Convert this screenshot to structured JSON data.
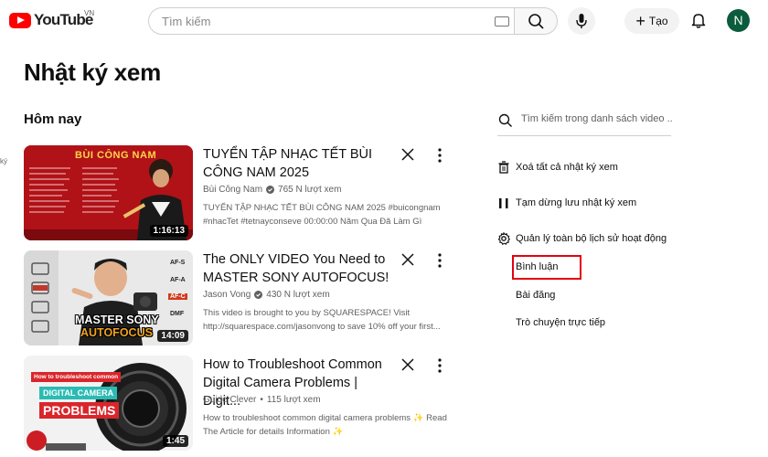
{
  "header": {
    "logo_text": "YouTube",
    "country": "VN",
    "search_placeholder": "Tìm kiếm",
    "create_label": "Tạo",
    "avatar_letter": "N"
  },
  "page": {
    "title": "Nhật ký xem",
    "section": "Hôm nay",
    "edge_label": "ký"
  },
  "videos": [
    {
      "title": "TUYỂN TẬP NHẠC TẾT BÙI CÔNG NAM 2025",
      "channel": "Bùi Công Nam",
      "views": "765 N lượt xem",
      "desc": "TUYỂN TẬP NHẠC TẾT BÙI CÔNG NAM 2025 #buicongnam #nhacTet #tetnayconseve 00:00:00 Năm Qua Đã Làm Gì 00:03:58...",
      "duration": "1:16:13",
      "thumb_text": "BÙI CÔNG NAM"
    },
    {
      "title": "The ONLY VIDEO You Need to MASTER SONY AUTOFOCUS!",
      "channel": "Jason Vong",
      "views": "430 N lượt xem",
      "desc": "This video is brought to you by SQUARESPACE! Visit http://squarespace.com/jasonvong to save 10% off your first...",
      "duration": "14:09",
      "thumb_text_1": "MASTER SONY",
      "thumb_text_2": "AUTOFOCUS",
      "thumb_tags": [
        "AF-S",
        "AF-A",
        "AF-C",
        "DMF"
      ]
    },
    {
      "title": "How to Troubleshoot Common Digital Camera Problems | Digit...",
      "channel": "Guide Clever",
      "views": "115 lượt xem",
      "desc": "How to troubleshoot common digital camera problems ✨ Read The Article for details Information ✨ https://guideclever.com/common...",
      "duration": "1:45",
      "thumb_text_1": "How to troubleshoot common",
      "thumb_text_2": "DIGITAL CAMERA",
      "thumb_text_3": "PROBLEMS"
    }
  ],
  "sidebar": {
    "search_placeholder": "Tìm kiếm trong danh sách video ...",
    "clear": "Xoá tất cả nhật ký xem",
    "pause": "Tạm dừng lưu nhật ký xem",
    "manage": "Quản lý toàn bộ lịch sử hoạt động",
    "sub": [
      "Bình luận",
      "Bài đăng",
      "Trò chuyện trực tiếp"
    ]
  },
  "colors": {
    "youtube_red": "#ff0000",
    "highlight_red": "#e4000f",
    "avatar_green": "#0b5c3c"
  }
}
